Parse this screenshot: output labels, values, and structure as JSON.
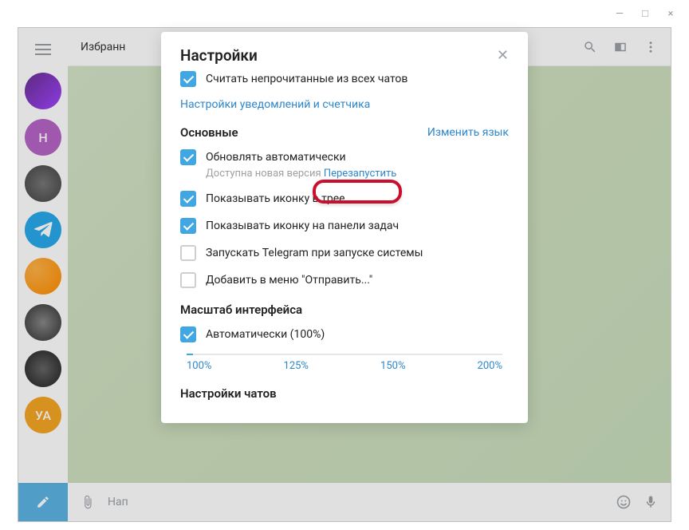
{
  "window": {
    "minimize": "—",
    "maximize": "□",
    "close": "×"
  },
  "chat_title": "Избранн",
  "input_placeholder": "Нап",
  "modal": {
    "title": "Настройки",
    "unread_label": "Считать непрочитанные из всех чатов",
    "notif_link": "Настройки уведомлений и счетчика",
    "section_basic": "Основные",
    "change_lang": "Изменить язык",
    "auto_update": "Обновлять автоматически",
    "new_version_prefix": "Доступна новая версия",
    "restart": "Перезапустить",
    "tray_icon": "Показывать иконку в трее",
    "taskbar_icon": "Показывать иконку на панели задач",
    "launch_startup": "Запускать Telegram при запуске системы",
    "add_sendto": "Добавить в меню \"Отправить...\"",
    "section_scale": "Масштаб интерфейса",
    "scale_auto": "Автоматически (100%)",
    "scale_marks": [
      "100%",
      "125%",
      "150%",
      "200%"
    ],
    "section_chats": "Настройки чатов"
  },
  "rail_avatars": [
    {
      "bg": "linear-gradient(135deg,#6a3093,#a044ff)"
    },
    {
      "bg": "#b565c6",
      "letter": "Н"
    },
    {
      "bg": "radial-gradient(circle,#777,#444)"
    },
    {
      "bg": "#29a9eb",
      "tg": true
    },
    {
      "bg": "radial-gradient(circle at 30% 30%,#ffb347,#ff8c00)"
    },
    {
      "bg": "radial-gradient(circle,#888,#333)"
    },
    {
      "bg": "radial-gradient(circle,#666,#222)"
    },
    {
      "bg": "#f5a623",
      "letter": "УА"
    }
  ]
}
